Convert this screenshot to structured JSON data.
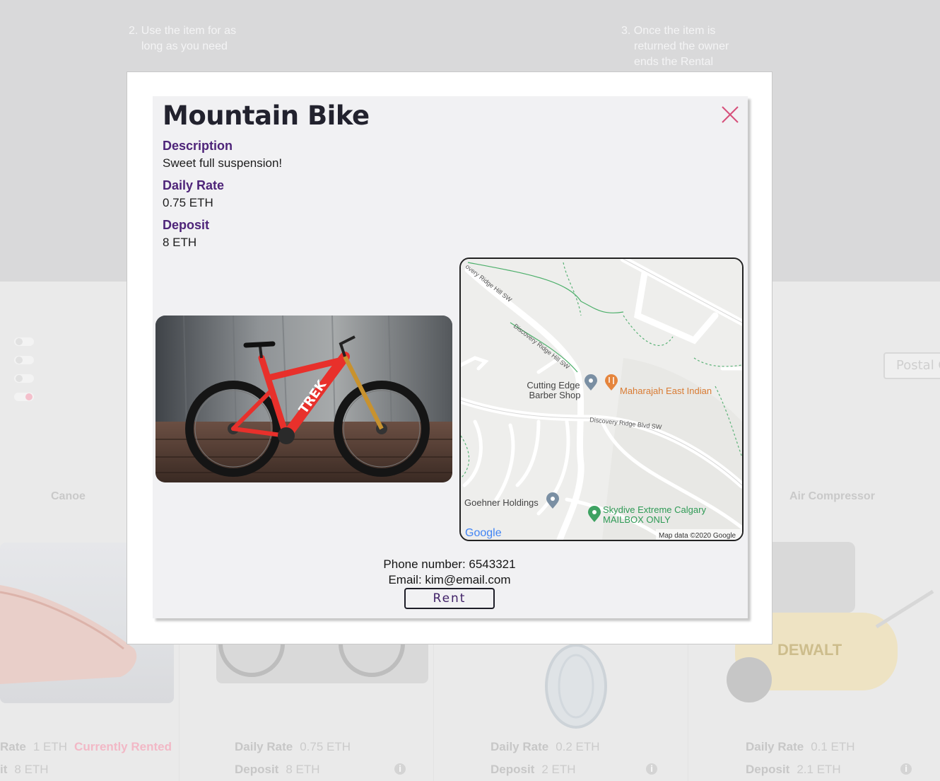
{
  "background": {
    "steps": [
      {
        "line1": "2. Use the item for as",
        "line2": "long as you need",
        "line3": ""
      },
      {
        "line1": "3. Once the item is",
        "line2": "returned the owner",
        "line3": "ends the Rental"
      }
    ],
    "postal_placeholder": "Postal C",
    "cards": [
      {
        "title": "Canoe",
        "rate_label": "Rate",
        "rate": "1 ETH",
        "status": "Currently Rented",
        "deposit_label": "it",
        "deposit": "8 ETH"
      },
      {
        "title": "",
        "rate_label": "Daily Rate",
        "rate": "0.75 ETH",
        "deposit_label": "Deposit",
        "deposit": "8 ETH"
      },
      {
        "title": "",
        "rate_label": "Daily Rate",
        "rate": "0.2 ETH",
        "deposit_label": "Deposit",
        "deposit": "2 ETH"
      },
      {
        "title": "Air Compressor",
        "rate_label": "Daily Rate",
        "rate": "0.1 ETH",
        "deposit_label": "Deposit",
        "deposit": "2.1 ETH"
      }
    ],
    "info_glyph": "i"
  },
  "modal": {
    "title": "Mountain Bike",
    "close_icon": "close-icon",
    "description_label": "Description",
    "description": "Sweet full suspension!",
    "rate_label": "Daily Rate",
    "rate": "0.75 ETH",
    "deposit_label": "Deposit",
    "deposit": "8 ETH",
    "phone": "Phone number: 6543321",
    "email": "Email: kim@email.com",
    "rent_label": "Rent",
    "bike_brand": "TREK",
    "colors": {
      "accent": "#4e2479",
      "close": "#d6507a",
      "bike": "#e8302b"
    }
  },
  "map": {
    "roads": [
      "overy Ridge Hill SW",
      "Discovery Ridge Hill SW",
      "Discovery Ridge Blvd SW"
    ],
    "places": [
      {
        "name_line1": "Cutting Edge",
        "name_line2": "Barber Shop"
      },
      {
        "name_line1": "Maharajah East Indian",
        "name_line2": ""
      },
      {
        "name_line1": "Goehner Holdings",
        "name_line2": ""
      },
      {
        "name_line1": "Skydive Extreme Calgary",
        "name_line2": "MAILBOX ONLY"
      }
    ],
    "logo": "Google",
    "attribution": "Map data ©2020 Google"
  }
}
